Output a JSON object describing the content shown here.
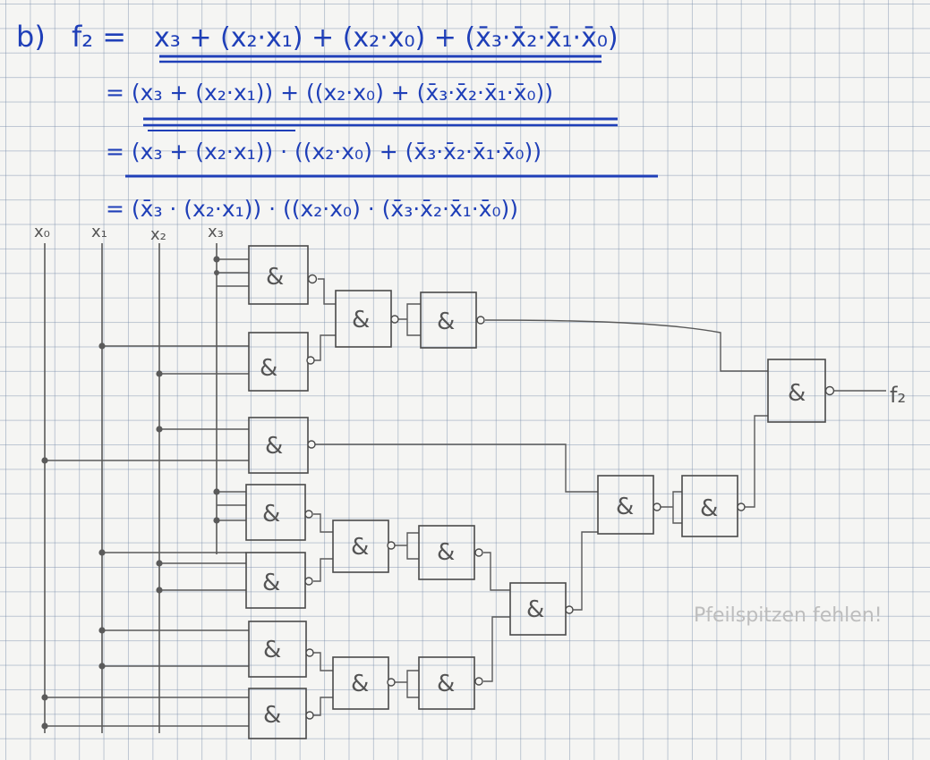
{
  "equation": {
    "label": "b)",
    "lhs": "f₂ =",
    "line1": "x₃ + (x₂·x₁) + (x₂·x₀) + (x̄₃·x̄₂·x̄₁·x̄₀)",
    "line2": "= (x₃ + (x₂·x₁)) + ((x₂·x₀) + (x̄₃·x̄₂·x̄₁·x̄₀))",
    "line3": "= (x₃ + (x₂·x₁)) · ((x₂·x₀) + (x̄₃·x̄₂·x̄₁·x̄₀))",
    "line4": "= (x̄₃ · (x₂·x₁)) · ((x₂·x₀) · (x̄₃·x̄₂·x̄₁·x̄₀))"
  },
  "circuit": {
    "inputs": [
      "x₀",
      "x₁",
      "x₂",
      "x₃"
    ],
    "gate_symbol": "&",
    "output": "f₂"
  },
  "background_notes": {
    "note": "Pfeilspitzen fehlen!"
  }
}
